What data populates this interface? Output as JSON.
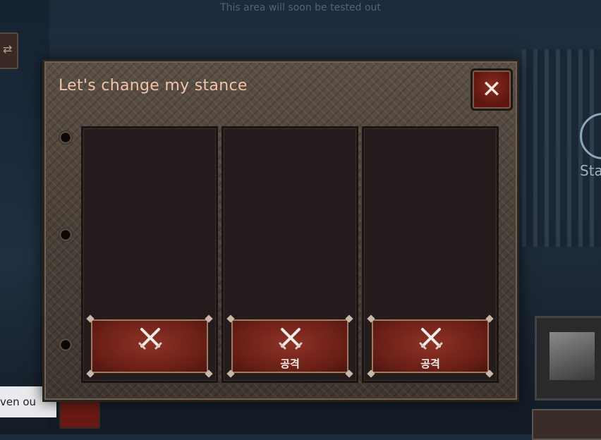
{
  "background": {
    "top_text": "This area will soon be tested out",
    "left_text": "ven ou",
    "right_text": "Sta"
  },
  "modal": {
    "title": "Let's change my stance",
    "close_icon": "close-icon",
    "slots": [
      {
        "icon": "crossed-swords-icon",
        "label": ""
      },
      {
        "icon": "crossed-swords-icon",
        "label": "공격"
      },
      {
        "icon": "crossed-swords-icon",
        "label": "공격"
      }
    ]
  },
  "colors": {
    "title": "#f2c3a8",
    "button_red": "#8e3226",
    "slot_bg": "#241c1c"
  }
}
